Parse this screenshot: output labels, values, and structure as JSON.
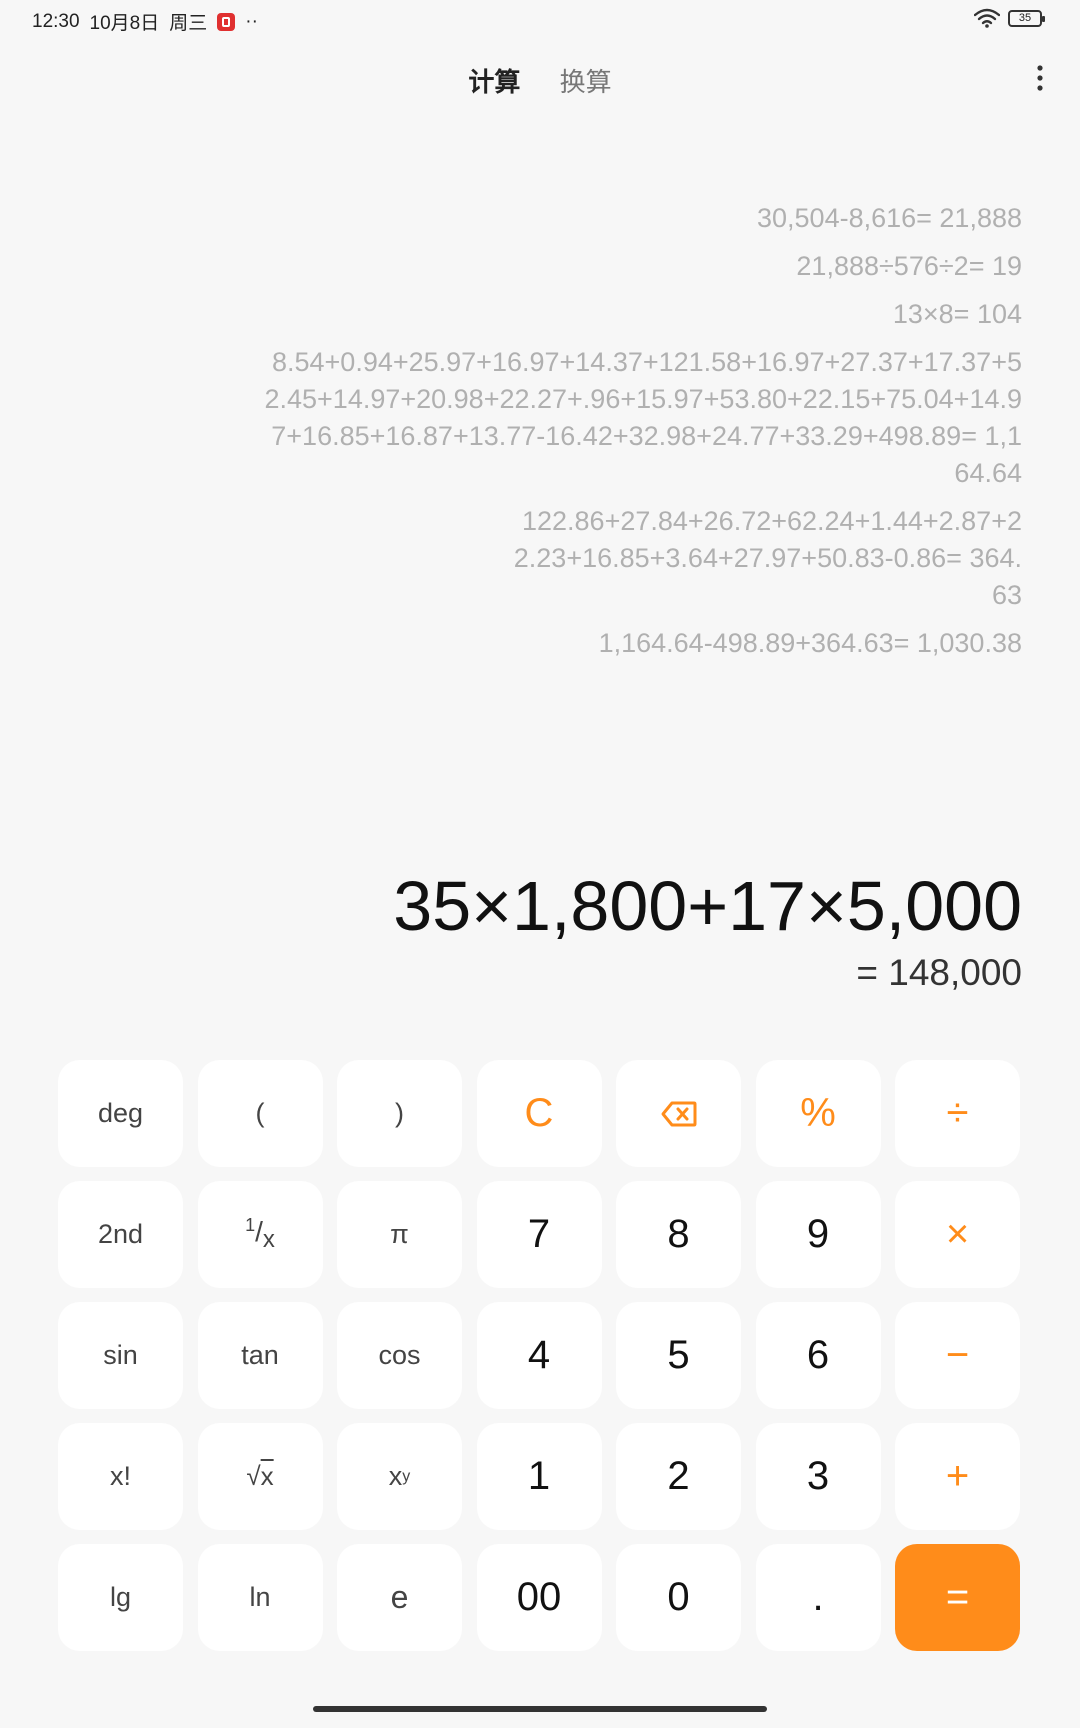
{
  "status_bar": {
    "time": "12:30",
    "date": "10月8日",
    "weekday": "周三",
    "dots": "··",
    "battery": "35"
  },
  "tabs": [
    {
      "label": "计算",
      "active": true
    },
    {
      "label": "换算",
      "active": false
    }
  ],
  "history": [
    {
      "text": "30,504-8,616= 21,888"
    },
    {
      "text": "21,888÷576÷2= 19"
    },
    {
      "text": "13×8= 104"
    },
    {
      "text": "8.54+0.94+25.97+16.97+14.37+121.58+16.97+27.37+17.37+52.45+14.97+20.98+22.27+.96+15.97+53.80+22.15+75.04+14.97+16.85+16.87+13.77-16.42+32.98+24.77+33.29+498.89= 1,164.64"
    },
    {
      "text": "122.86+27.84+26.72+62.24+1.44+2.87+22.23+16.85+3.64+27.97+50.83-0.86= 364.63"
    },
    {
      "text": "1,164.64-498.89+364.63= 1,030.38"
    }
  ],
  "display": {
    "expression": "35×1,800+17×5,000",
    "result": "= 148,000"
  },
  "keys": {
    "deg": "deg",
    "open_paren": "(",
    "close_paren": ")",
    "clear": "C",
    "percent": "%",
    "divide": "÷",
    "second": "2nd",
    "reciprocal_num": "1",
    "reciprocal_den": "x",
    "pi": "π",
    "seven": "7",
    "eight": "8",
    "nine": "9",
    "multiply": "×",
    "sin": "sin",
    "tan": "tan",
    "cos": "cos",
    "four": "4",
    "five": "5",
    "six": "6",
    "minus": "−",
    "factorial": "x!",
    "sqrt": "x",
    "power_base": "x",
    "power_exp": "y",
    "one": "1",
    "two": "2",
    "three": "3",
    "plus": "+",
    "lg": "lg",
    "ln": "ln",
    "e": "e",
    "double_zero": "00",
    "zero": "0",
    "dot": ".",
    "equals": "="
  },
  "colors": {
    "accent": "#ff8c1a",
    "background": "#f7f7f7",
    "key_background": "#ffffff",
    "history_text": "#b0b0b0"
  }
}
